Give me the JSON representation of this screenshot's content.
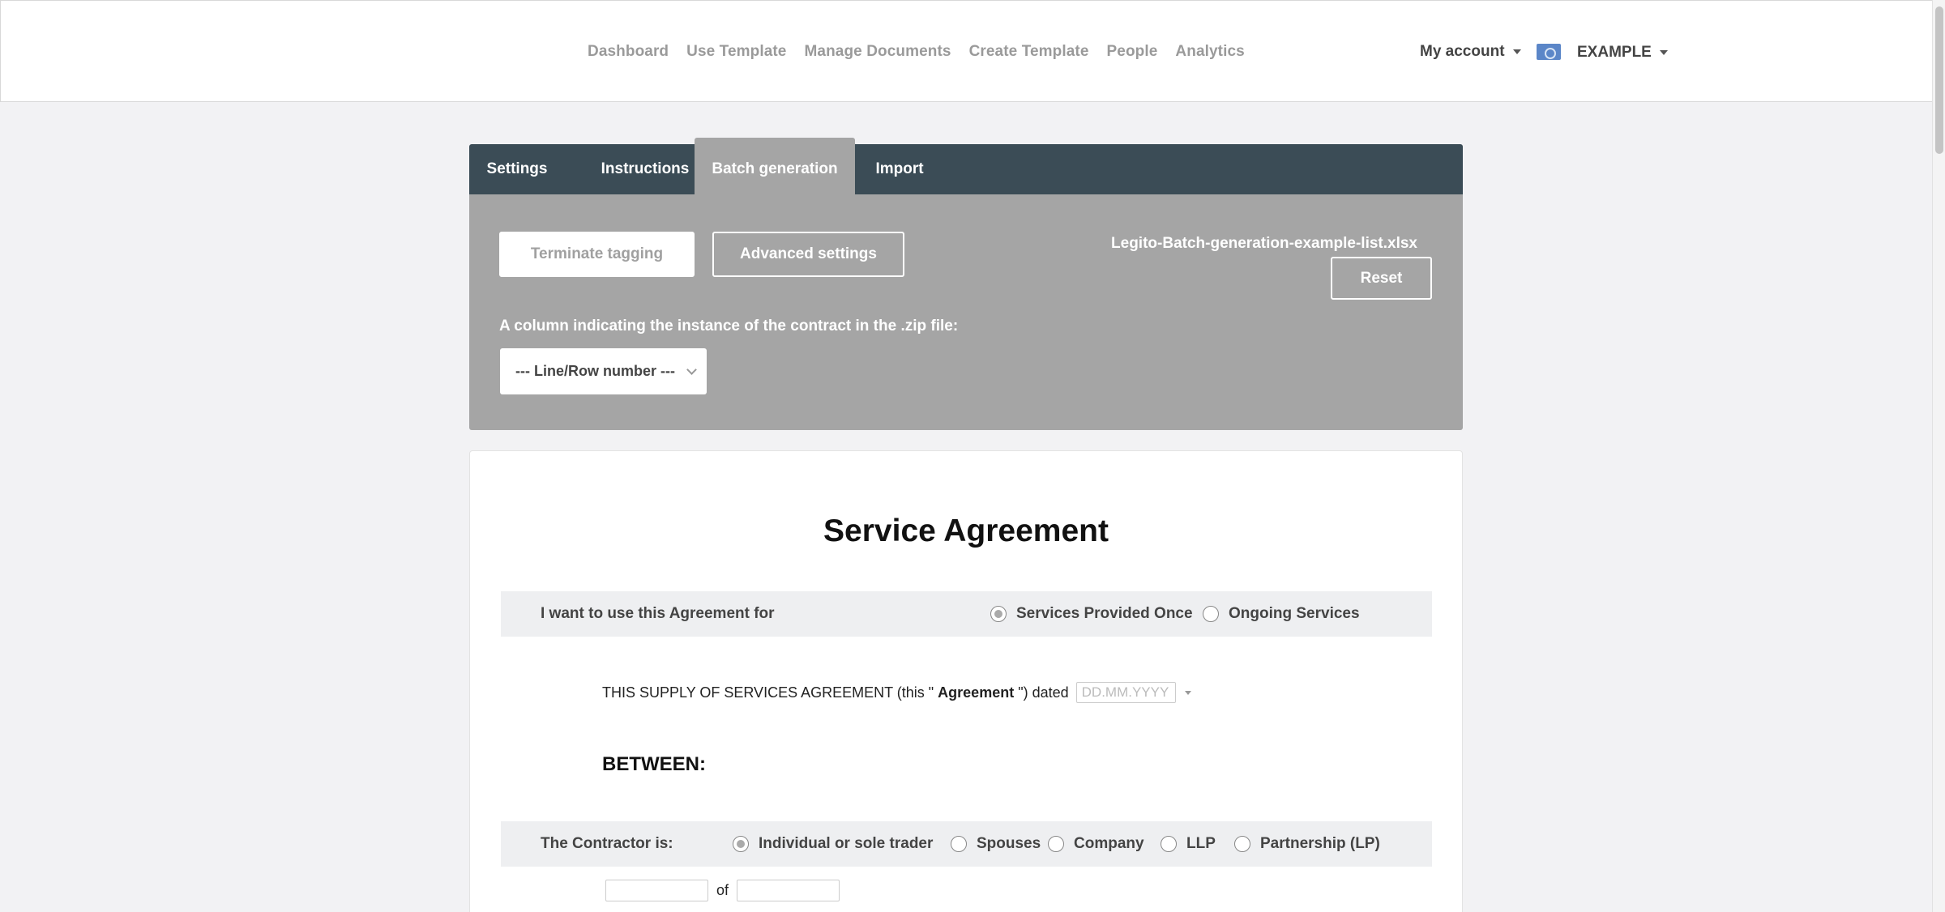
{
  "nav": {
    "links": [
      "Dashboard",
      "Use Template",
      "Manage Documents",
      "Create Template",
      "People",
      "Analytics"
    ],
    "account_label": "My account",
    "org_label": "EXAMPLE"
  },
  "tabs": [
    {
      "label": "Settings",
      "active": false
    },
    {
      "label": "Instructions",
      "active": false
    },
    {
      "label": "Batch generation",
      "active": true
    },
    {
      "label": "Import",
      "active": false
    }
  ],
  "batch": {
    "terminate_label": "Terminate tagging",
    "advanced_label": "Advanced settings",
    "filename": "Legito-Batch-generation-example-list.xlsx",
    "reset_label": "Reset",
    "column_label": "A column indicating the instance of the contract in the .zip file:",
    "column_select_value": "--- Line/Row number ---"
  },
  "document": {
    "title": "Service Agreement",
    "use_for": {
      "label": "I want to use this Agreement for",
      "options": [
        {
          "label": "Services Provided Once",
          "selected": true
        },
        {
          "label": "Ongoing Services",
          "selected": false
        }
      ]
    },
    "agreement_line": {
      "prefix": "THIS SUPPLY OF SERVICES AGREEMENT (this \"",
      "bold": "Agreement",
      "suffix": "\") dated",
      "date_placeholder": "DD.MM.YYYY"
    },
    "between": "BETWEEN:",
    "contractor": {
      "label": "The Contractor is:",
      "options": [
        {
          "label": "Individual or sole trader",
          "selected": true
        },
        {
          "label": "Spouses",
          "selected": false
        },
        {
          "label": "Company",
          "selected": false
        },
        {
          "label": "LLP",
          "selected": false
        },
        {
          "label": "Partnership (LP)",
          "selected": false
        }
      ]
    },
    "of_label": "of"
  },
  "colors": {
    "tabbar": "#3b4c56",
    "panel": "#a5a5a5",
    "page_bg": "#f2f2f4"
  }
}
